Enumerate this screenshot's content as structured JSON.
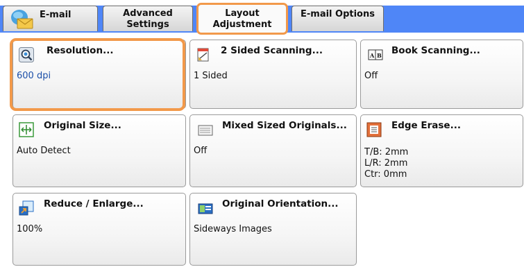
{
  "tabs": [
    {
      "label": "E-mail"
    },
    {
      "label_line1": "Advanced",
      "label_line2": "Settings"
    },
    {
      "label_line1": "Layout",
      "label_line2": "Adjustment"
    },
    {
      "label": "E-mail Options"
    }
  ],
  "buttons": {
    "resolution": {
      "title": "Resolution...",
      "value": "600 dpi"
    },
    "two_sided": {
      "title": "2 Sided Scanning...",
      "value": "1 Sided"
    },
    "book": {
      "title": "Book Scanning...",
      "value": "Off"
    },
    "original_size": {
      "title": "Original Size...",
      "value": "Auto Detect"
    },
    "mixed": {
      "title": "Mixed Sized Originals...",
      "value": "Off"
    },
    "edge_erase": {
      "title": "Edge Erase...",
      "value_tb": "T/B: 2mm",
      "value_lr": "L/R: 2mm",
      "value_ctr": "Ctr: 0mm"
    },
    "reduce": {
      "title": "Reduce / Enlarge...",
      "value": "100%"
    },
    "orientation": {
      "title": "Original Orientation...",
      "value": "Sideways Images"
    }
  },
  "colors": {
    "selection": "#f2994a",
    "tab_band": "#4f86f7",
    "value_blue": "#1b4fa8"
  },
  "icons": [
    "email-icon",
    "magnifier-icon",
    "two-sided-icon",
    "book-icon",
    "original-size-icon",
    "mixed-originals-icon",
    "edge-erase-icon",
    "reduce-enlarge-icon",
    "orientation-icon"
  ]
}
